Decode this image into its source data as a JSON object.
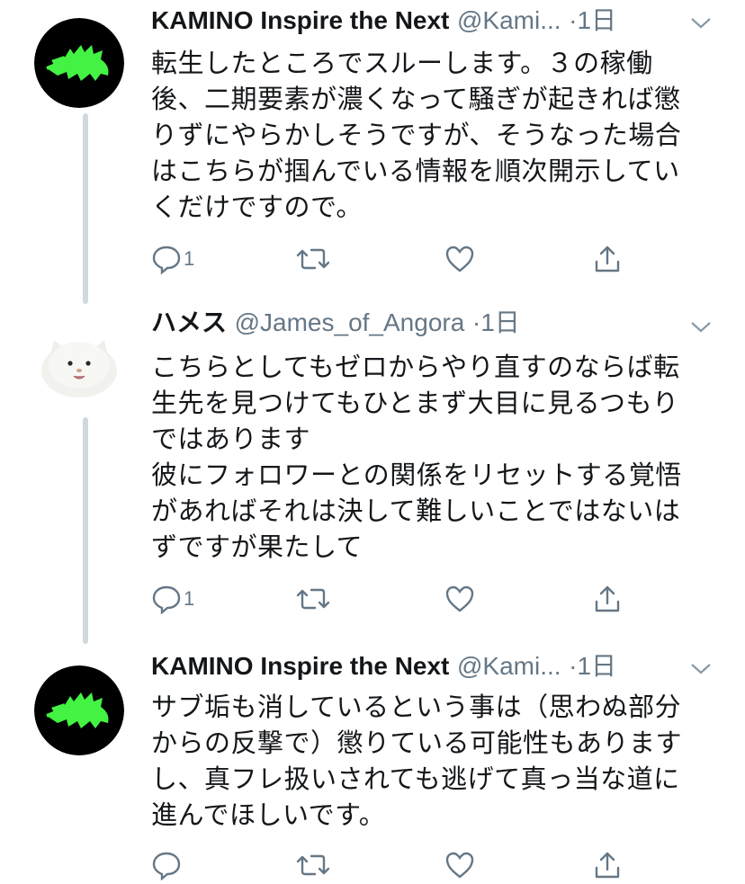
{
  "tweets": [
    {
      "name": "KAMINO Inspire the Next",
      "handle": "@Kami...",
      "time": "·1日",
      "avatar_icon": "green-crocodile-icon",
      "lines": [
        "転生したところでスルーします。３の稼働",
        "後、二期要素が濃くなって騒ぎが起きれば懲",
        "りずにやらかしそうですが、そうなった場合",
        "はこちらが掴んでいる情報を順次開示してい",
        "くだけですので。"
      ],
      "reply_count": "1"
    },
    {
      "name": "ハメス",
      "handle": "@James_of_Angora",
      "time": "·1日",
      "avatar_icon": "white-cat-icon",
      "lines": [
        "こちらとしてもゼロからやり直すのならば転",
        "生先を見つけてもひとまず大目に見るつもり",
        "ではあります",
        "彼にフォロワーとの関係をリセットする覚悟",
        "があればそれは決して難しいことではないは",
        "ずですが果たして"
      ],
      "reply_count": "1"
    },
    {
      "name": "KAMINO Inspire the Next",
      "handle": "@Kami...",
      "time": "·1日",
      "avatar_icon": "green-crocodile-icon",
      "lines": [
        "サブ垢も消しているという事は（思わぬ部分",
        "からの反撃で）懲りている可能性もあります",
        "し、真フレ扱いされても逃げて真っ当な道に",
        "進んでほしいです。"
      ],
      "reply_count": ""
    }
  ],
  "colors": {
    "accent_green": "#44f244",
    "thread_line": "#cfd9de",
    "muted": "#657786"
  }
}
